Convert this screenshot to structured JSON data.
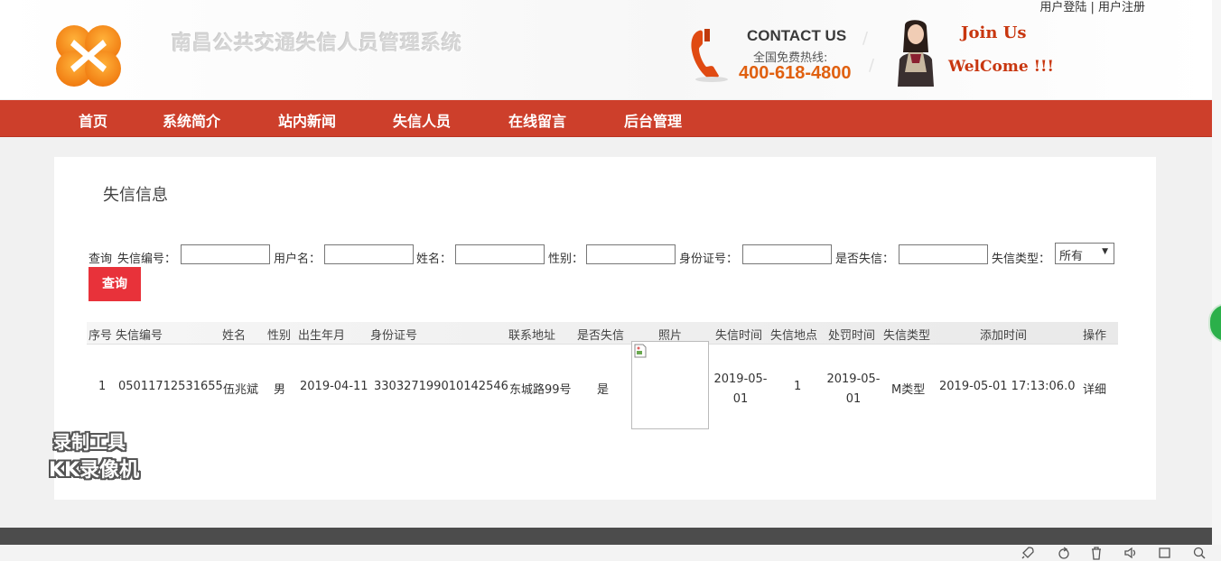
{
  "header": {
    "site_title": "南昌公共交通失信人员管理系统",
    "auth": {
      "login": "用户登陆",
      "separator": " | ",
      "register": "用户注册"
    },
    "contact": {
      "title": "CONTACT US",
      "subtitle": "全国免费热线:",
      "phone": "400-618-4800"
    },
    "join": "Join Us",
    "welcome": "WelCome !!!"
  },
  "nav": {
    "items": [
      "首页",
      "系统简介",
      "站内新闻",
      "失信人员",
      "在线留言",
      "后台管理"
    ]
  },
  "main": {
    "title": "失信信息",
    "search": {
      "prefix": "查询",
      "fields": [
        {
          "label": "失信编号：",
          "value": ""
        },
        {
          "label": "用户名：",
          "value": ""
        },
        {
          "label": "姓名：",
          "value": ""
        },
        {
          "label": "性别：",
          "value": ""
        },
        {
          "label": "身份证号：",
          "value": ""
        },
        {
          "label": "是否失信：",
          "value": ""
        }
      ],
      "type_label": "失信类型：",
      "type_selected": "所有",
      "button": "查询"
    },
    "table": {
      "headers": [
        "序号",
        "失信编号",
        "姓名",
        "性别",
        "出生年月",
        "身份证号",
        "联系地址",
        "是否失信",
        "照片",
        "失信时间",
        "失信地点",
        "处罚时间",
        "失信类型",
        "添加时间",
        "操作"
      ],
      "rows": [
        {
          "index": "1",
          "code": "05011712531655",
          "name": "伍兆斌",
          "gender": "男",
          "birth": "2019-04-11",
          "id_number": "330327199010142546",
          "address": "东城路99号",
          "is_dishonest": "是",
          "dishonest_time_line1": "2019-05-",
          "dishonest_time_line2": "01",
          "location": "1",
          "punish_time_line1": "2019-05-",
          "punish_time_line2": "01",
          "type": "M类型",
          "added": "2019-05-01 17:13:06.0",
          "action": "详细"
        }
      ]
    }
  },
  "watermark": {
    "line1": "录制工具",
    "line2": "KK录像机"
  },
  "colors": {
    "nav_bg": "#cd3f2b",
    "button_bg": "#e8323a",
    "accent_orange": "#e06010"
  },
  "icons": [
    "logo-icon",
    "phone-icon",
    "avatar-image",
    "broken-image-icon",
    "rocket-icon",
    "refresh-icon",
    "trash-icon",
    "volume-icon",
    "window-icon",
    "search-icon"
  ]
}
